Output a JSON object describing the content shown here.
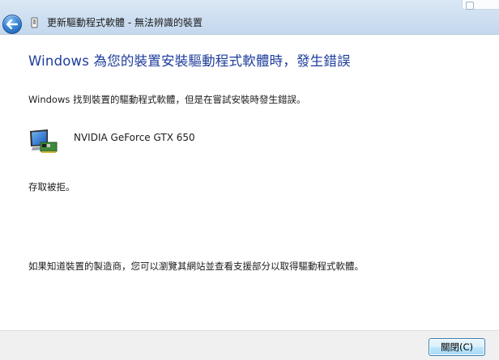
{
  "window": {
    "title": "更新驅動程式軟體 - 無法辨識的裝置",
    "back_icon": "back-arrow-icon",
    "title_icon": "device-icon"
  },
  "main": {
    "heading": "Windows 為您的裝置安裝驅動程式軟體時，發生錯誤",
    "description": "Windows 找到裝置的驅動程式軟體，但是在嘗試安裝時發生錯誤。",
    "device": {
      "icon": "monitor-graphics-card-icon",
      "name": "NVIDIA GeForce GTX 650"
    },
    "error": "存取被拒。",
    "hint": "如果知道裝置的製造商，您可以瀏覽其網站並查看支援部分以取得驅動程式軟體。"
  },
  "footer": {
    "close_label": "關閉(C)"
  },
  "colors": {
    "heading": "#1e3d9b",
    "titlebar": "#cfe0f1",
    "footer": "#f0f0f0"
  }
}
